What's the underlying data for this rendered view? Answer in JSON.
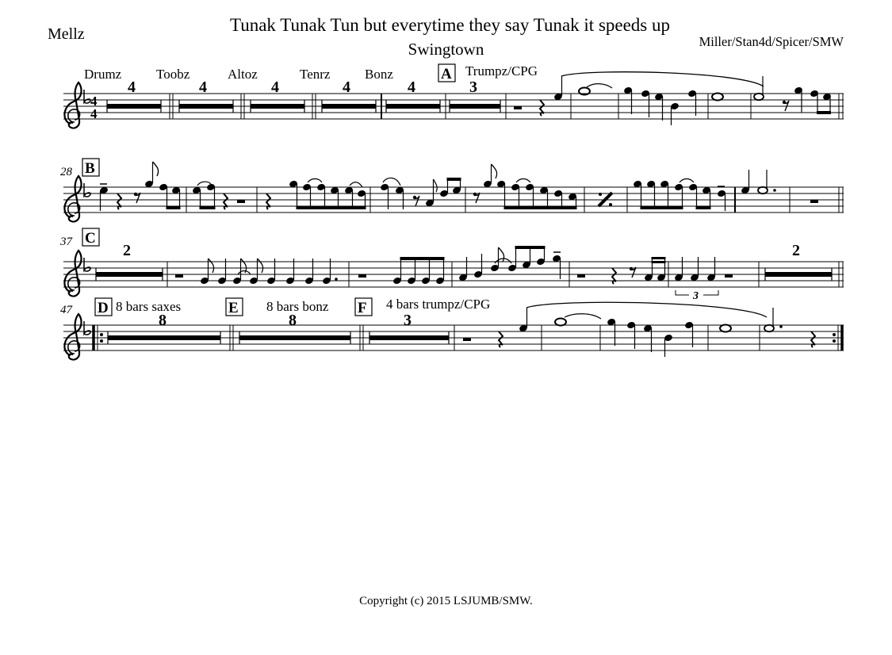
{
  "header": {
    "title": "Tunak Tunak Tun but everytime they say Tunak it speeds up",
    "subtitle": "Swingtown",
    "instrument": "Mellz",
    "composer": "Miller/Stan4d/Spicer/SMW"
  },
  "footer": {
    "copyright": "Copyright (c) 2015 LSJUMB/SMW."
  },
  "score": {
    "key_signature": "F major (1 flat)",
    "time_signature": "4/4",
    "time_signature_top": "4",
    "time_signature_bottom": "4",
    "triplet_label": "3",
    "systems": [
      {
        "measure_number": "",
        "rehearsal_mark": "A",
        "section_cues": [
          "Drumz",
          "Toobz",
          "Altoz",
          "Tenrz",
          "Bonz",
          "Trumpz/CPG"
        ],
        "multi_rests": [
          "4",
          "4",
          "4",
          "4",
          "4",
          "3"
        ]
      },
      {
        "measure_number": "28",
        "rehearsal_mark": "B",
        "section_cues": [],
        "multi_rests": []
      },
      {
        "measure_number": "37",
        "rehearsal_mark": "C",
        "section_cues": [],
        "multi_rests": [
          "2",
          "2"
        ]
      },
      {
        "measure_number": "47",
        "rehearsal_marks": [
          "D",
          "E",
          "F"
        ],
        "section_cues": [
          "8 bars saxes",
          "8 bars bonz",
          "4 bars trumpz/CPG"
        ],
        "multi_rests": [
          "8",
          "8",
          "3"
        ]
      }
    ]
  }
}
